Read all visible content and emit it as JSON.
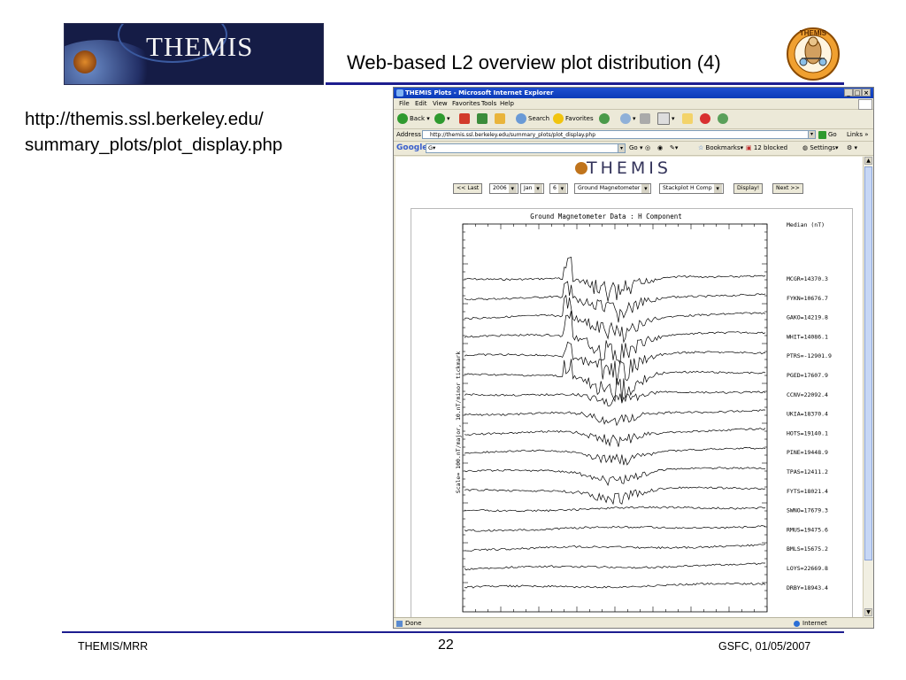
{
  "slide": {
    "logo_text": "THEMIS",
    "title": "Web-based L2 overview plot distribution (4)",
    "url_line1": "http://themis.ssl.berkeley.edu/",
    "url_line2": "summary_plots/plot_display.php",
    "mascot_text": "THEMIS",
    "footer_left": "THEMIS/MRR",
    "footer_center": "22",
    "footer_right": "GSFC, 01/05/2007"
  },
  "browser": {
    "title": "THEMIS Plots - Microsoft Internet Explorer",
    "menu": [
      "File",
      "Edit",
      "View",
      "Favorites",
      "Tools",
      "Help"
    ],
    "toolbar": {
      "back": "Back",
      "search": "Search",
      "favorites": "Favorites"
    },
    "address_label": "Address",
    "address_value": "http://themis.ssl.berkeley.edu/summary_plots/plot_display.php",
    "go_label": "Go",
    "links_label": "Links",
    "google_label": "Google",
    "google_input": "G▾",
    "google_go": "Go",
    "bookmarks": "Bookmarks▾",
    "blocked": "12 blocked",
    "settings": "Settings▾",
    "status": "Done",
    "zone": "Internet"
  },
  "page": {
    "logo": "THEMIS",
    "last_button": "<< Last",
    "year": "2006",
    "month": "Jan",
    "day": "6",
    "instrument": "Ground Magnetometer",
    "plot_type": "Stackplot H Comp",
    "display_button": "Display!",
    "next_button": "Next >>"
  },
  "chart_data": {
    "type": "line",
    "title": "Ground Magnetometer Data : H Component",
    "ylabel": "Scale= 100.nT/major, 10.nT/minor tickmark",
    "legend_title": "Median (nT)",
    "series": [
      {
        "name": "MCGR=14370.3"
      },
      {
        "name": "FYKN=10676.7"
      },
      {
        "name": "GAKO=14219.8"
      },
      {
        "name": "WHIT=14086.1"
      },
      {
        "name": "PTRS=-12901.9"
      },
      {
        "name": "PGED=17607.9"
      },
      {
        "name": "CCNV=22092.4"
      },
      {
        "name": "UKIA=18370.4"
      },
      {
        "name": "HOTS=19140.1"
      },
      {
        "name": "PINE=19448.9"
      },
      {
        "name": "TPAS=12411.2"
      },
      {
        "name": "FYTS=18021.4"
      },
      {
        "name": "SWNO=17679.3"
      },
      {
        "name": "RMUS=19475.6"
      },
      {
        "name": "BMLS=15675.2"
      },
      {
        "name": "LOYS=22669.8"
      },
      {
        "name": "DRBY=18943.4"
      }
    ]
  }
}
